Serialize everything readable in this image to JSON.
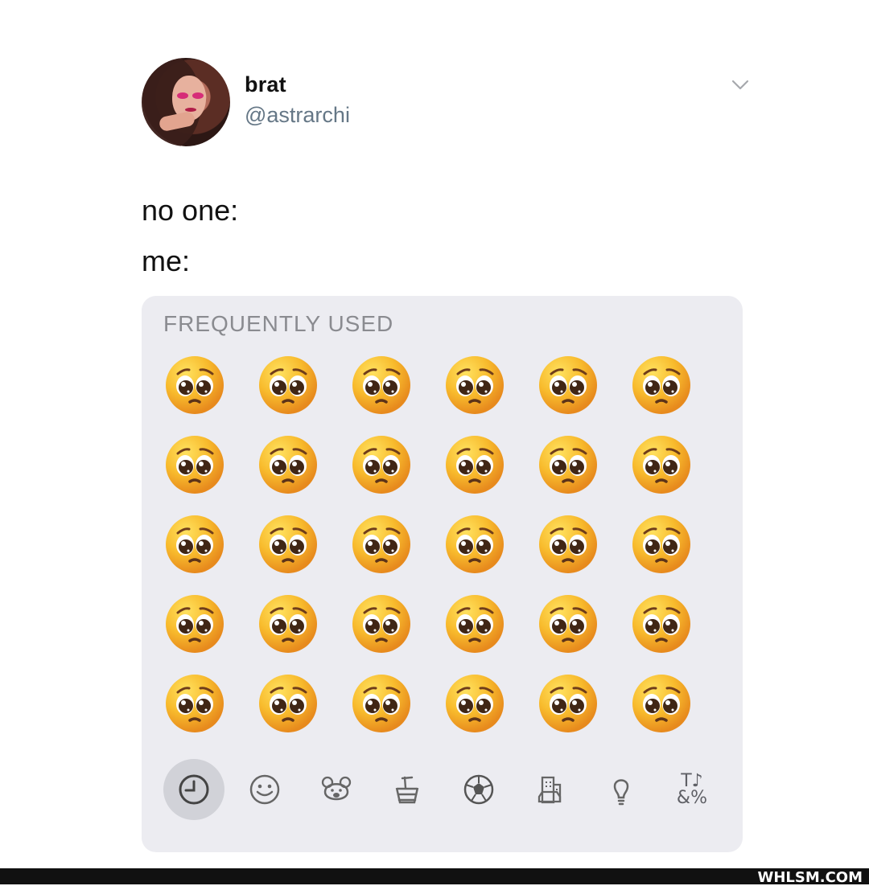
{
  "profile": {
    "display_name": "brat",
    "handle": "@astrarchi"
  },
  "tweet": {
    "lines": [
      "no one:",
      "me:"
    ]
  },
  "emoji_picker": {
    "section_title": "FREQUENTLY USED",
    "emoji": "pleading-face",
    "rows": 5,
    "columns": 6,
    "categories": [
      {
        "name": "recent-icon",
        "active": true
      },
      {
        "name": "smiley-icon",
        "active": false
      },
      {
        "name": "animal-icon",
        "active": false
      },
      {
        "name": "food-icon",
        "active": false
      },
      {
        "name": "sports-ball-icon",
        "active": false
      },
      {
        "name": "travel-icon",
        "active": false
      },
      {
        "name": "lightbulb-icon",
        "active": false
      },
      {
        "name": "symbols-icon",
        "active": false
      }
    ]
  },
  "watermark": "WHLSM.COM"
}
